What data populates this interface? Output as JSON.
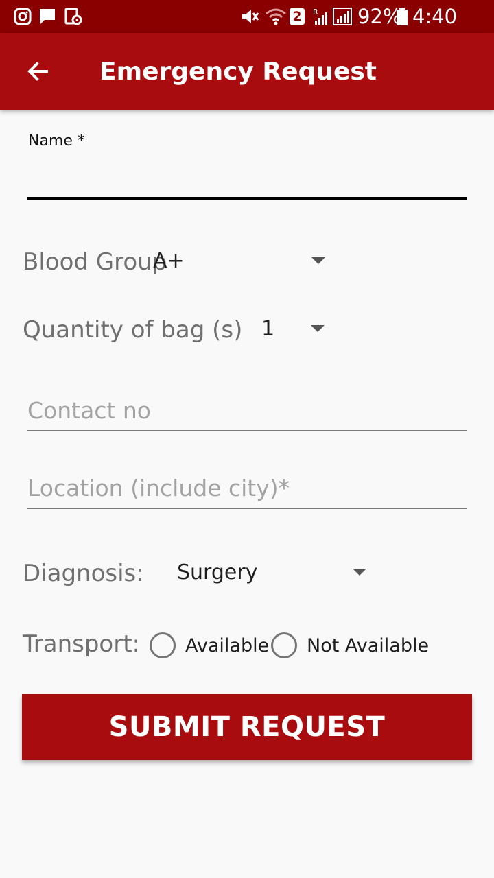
{
  "status_bar": {
    "battery": "92%",
    "time": "4:40 am",
    "sim_badge": "2",
    "icons": [
      "instagram-icon",
      "message-icon",
      "sync-document-icon",
      "mute-icon",
      "wifi-icon",
      "sim-badge-icon",
      "signal-icon",
      "battery-icon"
    ]
  },
  "app_bar": {
    "title": "Emergency Request",
    "back_icon": "arrow-back-icon",
    "background": "#a80c0e"
  },
  "form": {
    "name_label": "Name *",
    "name_value": "",
    "blood_group": {
      "label": "Blood Group",
      "value": "A+"
    },
    "quantity": {
      "label": "Quantity of bag (s)",
      "value": "1"
    },
    "contact": {
      "placeholder": "Contact no",
      "value": ""
    },
    "location": {
      "placeholder": "Location (include city)*",
      "value": ""
    },
    "diagnosis": {
      "label": "Diagnosis:",
      "value": "Surgery"
    },
    "transport": {
      "label": "Transport:",
      "options": [
        {
          "label": "Available",
          "selected": false
        },
        {
          "label": "Not Available",
          "selected": false
        }
      ]
    },
    "submit_label": "SUBMIT REQUEST"
  },
  "colors": {
    "status_bar": "#8a0000",
    "accent": "#a80c0e",
    "background": "#f9f9f9"
  }
}
